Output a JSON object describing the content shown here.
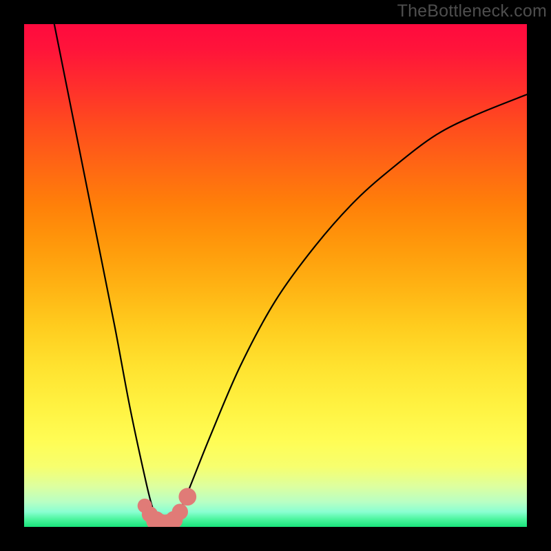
{
  "watermark": "TheBottleneck.com",
  "chart_data": {
    "type": "line",
    "title": "",
    "xlabel": "",
    "ylabel": "",
    "xlim": [
      0,
      100
    ],
    "ylim": [
      0,
      100
    ],
    "legend": false,
    "grid": false,
    "annotations": [],
    "background_gradient": {
      "direction": "vertical",
      "stops": [
        {
          "pos": 0.0,
          "color": "#ff0a3e"
        },
        {
          "pos": 0.2,
          "color": "#ff4b1e"
        },
        {
          "pos": 0.4,
          "color": "#ff8f0a"
        },
        {
          "pos": 0.6,
          "color": "#ffcc1e"
        },
        {
          "pos": 0.8,
          "color": "#fffb4d"
        },
        {
          "pos": 0.92,
          "color": "#dcffa0"
        },
        {
          "pos": 1.0,
          "color": "#19e37b"
        }
      ]
    },
    "series": [
      {
        "name": "bottleneck-curve",
        "color": "#000000",
        "x": [
          6,
          10,
          14,
          18,
          21,
          24,
          25.5,
          27,
          28,
          29,
          30.5,
          33,
          37,
          43,
          50,
          58,
          66,
          74,
          82,
          90,
          100
        ],
        "y": [
          100,
          80,
          60,
          40,
          24,
          10,
          4,
          1,
          0,
          0,
          2,
          8,
          18,
          32,
          45,
          56,
          65,
          72,
          78,
          82,
          86
        ]
      }
    ],
    "markers": [
      {
        "name": "valley-point",
        "x": 24.0,
        "y": 4.2,
        "r": 0.9,
        "color": "#e07b77"
      },
      {
        "name": "valley-point",
        "x": 25.0,
        "y": 2.5,
        "r": 1.0,
        "color": "#e07b77"
      },
      {
        "name": "valley-point",
        "x": 26.2,
        "y": 1.2,
        "r": 1.2,
        "color": "#e07b77"
      },
      {
        "name": "valley-point",
        "x": 27.4,
        "y": 0.6,
        "r": 1.2,
        "color": "#e07b77"
      },
      {
        "name": "valley-point",
        "x": 28.6,
        "y": 0.6,
        "r": 1.2,
        "color": "#e07b77"
      },
      {
        "name": "valley-point",
        "x": 29.8,
        "y": 1.4,
        "r": 1.1,
        "color": "#e07b77"
      },
      {
        "name": "valley-point",
        "x": 31.0,
        "y": 3.0,
        "r": 1.0,
        "color": "#e07b77"
      },
      {
        "name": "valley-point",
        "x": 32.5,
        "y": 6.0,
        "r": 1.1,
        "color": "#e07b77"
      }
    ]
  }
}
